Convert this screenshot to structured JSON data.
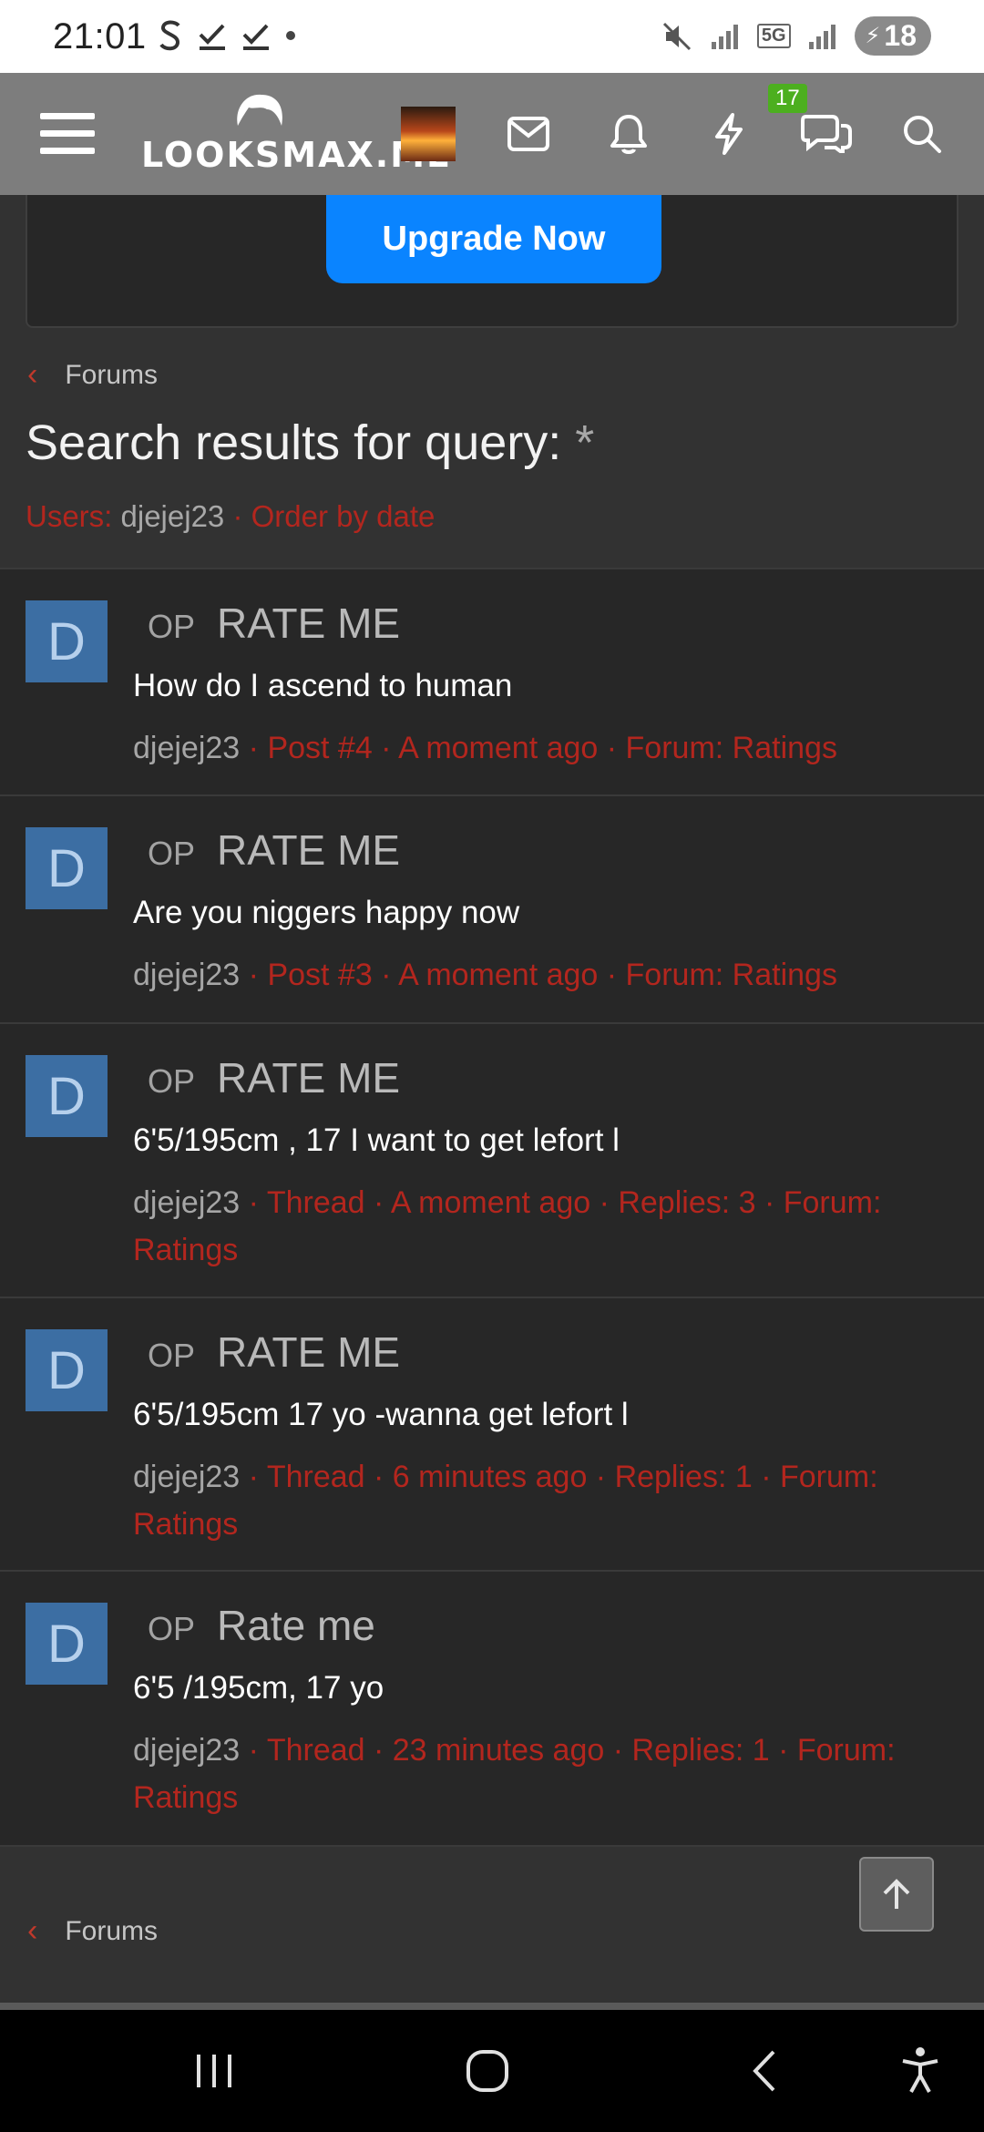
{
  "status_bar": {
    "time": "21:01",
    "battery": "18",
    "network": "5G"
  },
  "topnav": {
    "logo_text": "LOOKSMAX.ME",
    "chat_badge": "17"
  },
  "upgrade": {
    "label": "Upgrade Now"
  },
  "breadcrumb_top": {
    "label": "Forums"
  },
  "page_title": {
    "text": "Search results for query:",
    "query": "*"
  },
  "filters": {
    "users_label": "Users:",
    "username": "djejej23",
    "sep": "·",
    "order": "Order by date"
  },
  "results": [
    {
      "avatar": "D",
      "op": "OP",
      "title": "RATE ME",
      "snippet": "How do I ascend to human",
      "user": "djejej23",
      "meta": "· Post #4 · A moment ago · Forum: Ratings"
    },
    {
      "avatar": "D",
      "op": "OP",
      "title": "RATE ME",
      "snippet": "Are you niggers happy now",
      "user": "djejej23",
      "meta": "· Post #3 · A moment ago · Forum: Ratings"
    },
    {
      "avatar": "D",
      "op": "OP",
      "title": "RATE ME",
      "snippet": "6'5/195cm , 17 I want to get lefort l",
      "user": "djejej23",
      "meta": "· Thread · A moment ago · Replies: 3 · Forum: Ratings"
    },
    {
      "avatar": "D",
      "op": "OP",
      "title": "RATE ME",
      "snippet": "6'5/195cm 17 yo -wanna get lefort l",
      "user": "djejej23",
      "meta": "· Thread · 6 minutes ago · Replies: 1 · Forum: Ratings"
    },
    {
      "avatar": "D",
      "op": "OP",
      "title": "Rate me",
      "snippet": "6'5 /195cm, 17 yo",
      "user": "djejej23",
      "meta": "· Thread · 23 minutes ago · Replies: 1 · Forum: Ratings"
    }
  ],
  "breadcrumb_bottom": {
    "label": "Forums"
  },
  "colors": {
    "accent": "#b3261e",
    "nav_bg": "#7d7d7d",
    "upgrade_button": "#0a84ff",
    "avatar_bg": "#3c6ea3"
  }
}
